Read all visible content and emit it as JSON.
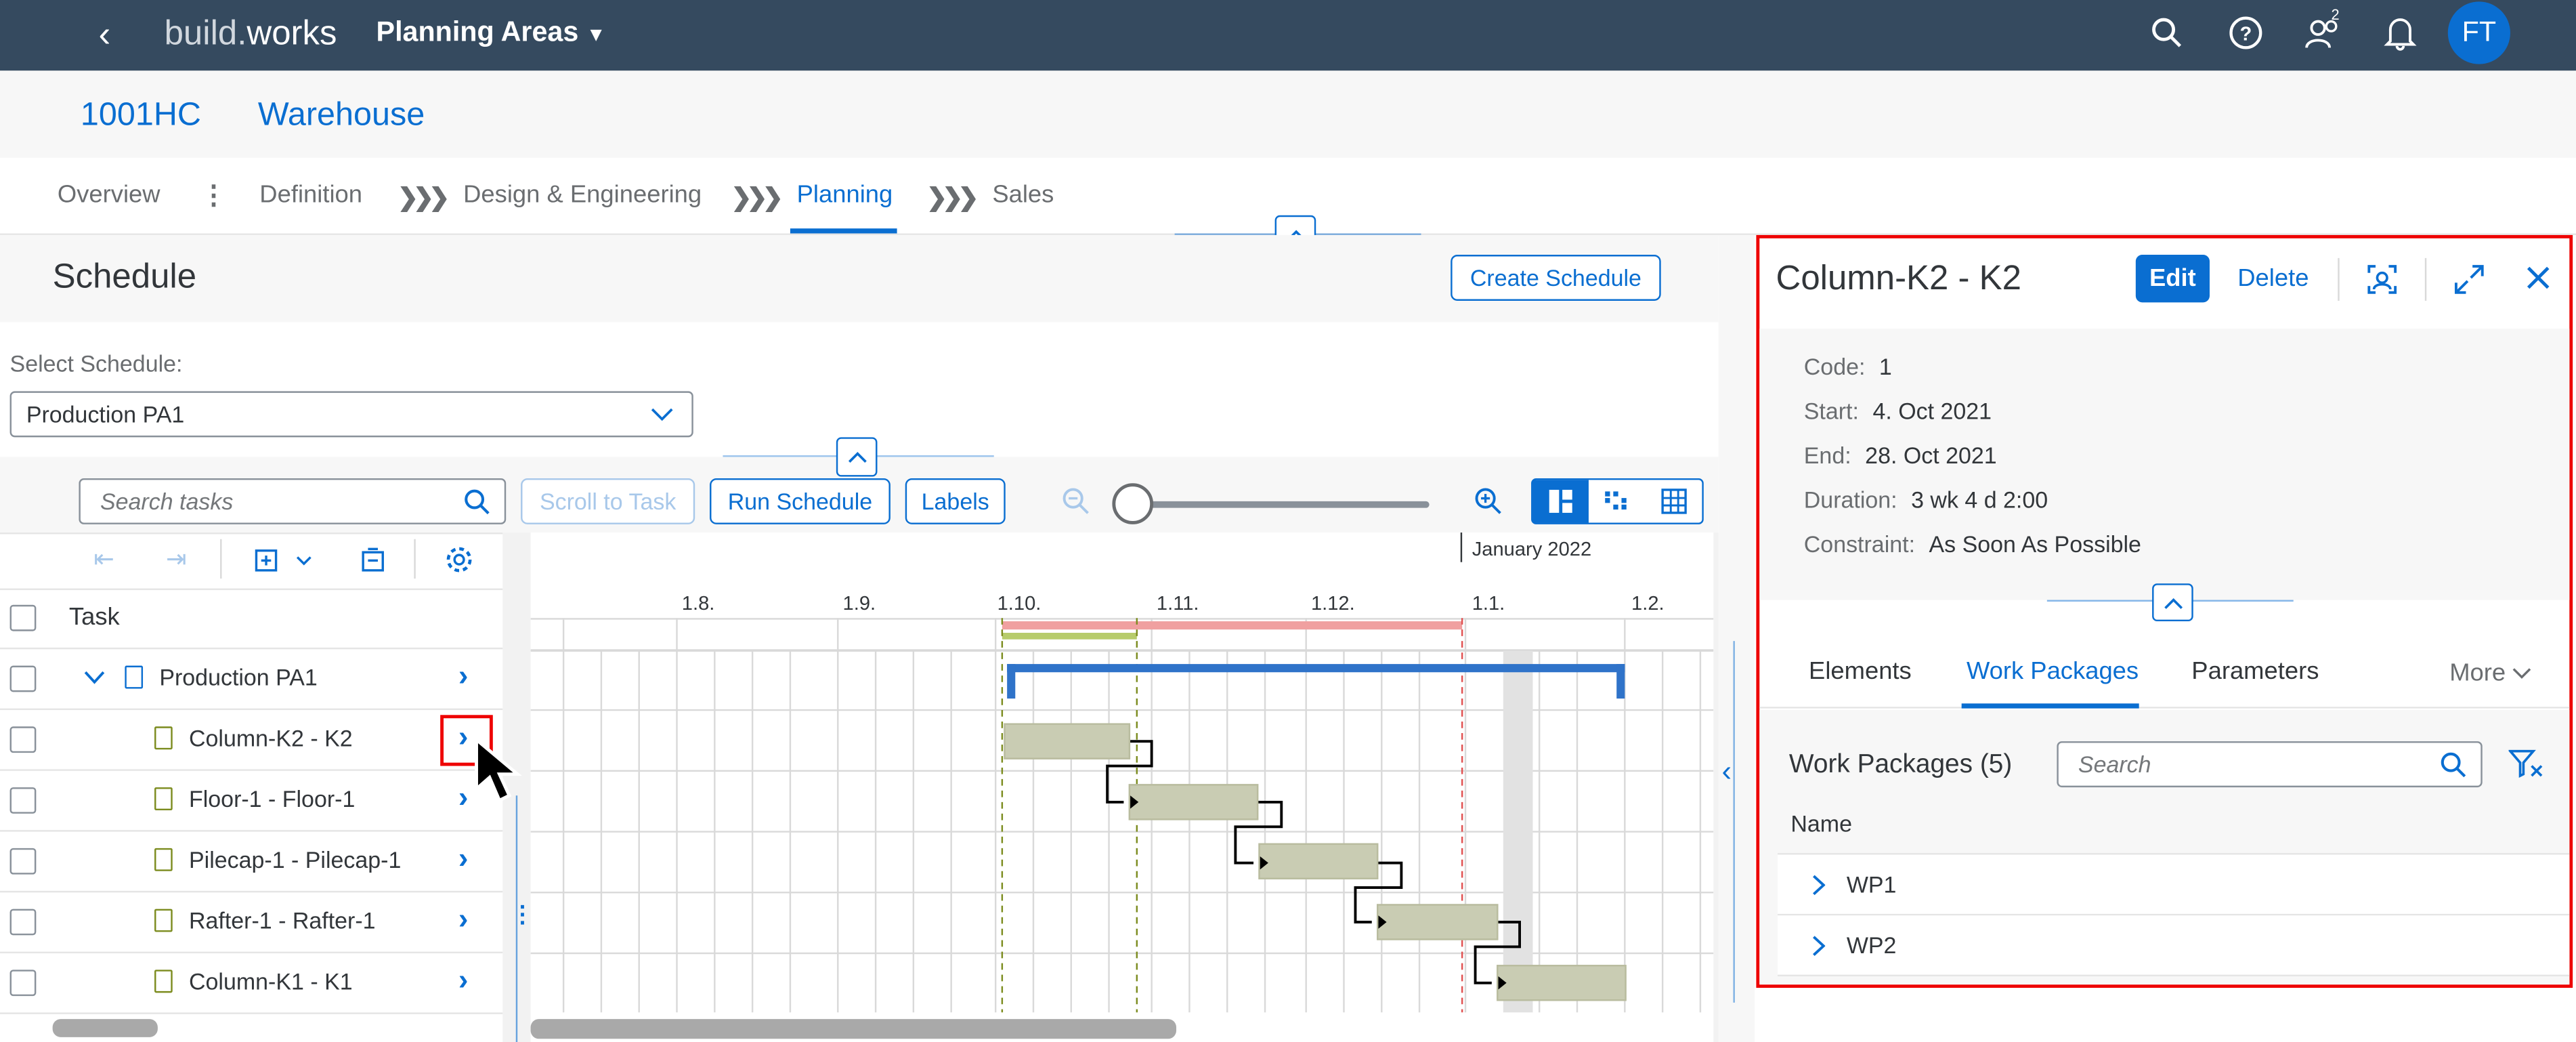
{
  "shell": {
    "app_name_1": "build.",
    "app_name_2": "works",
    "menu_title": "Planning Areas",
    "avatar": "FT",
    "notif_count": "2"
  },
  "header": {
    "id": "1001HC",
    "name": "Warehouse"
  },
  "nav": {
    "tabs": [
      "Overview",
      "Definition",
      "Design & Engineering",
      "Planning",
      "Sales"
    ],
    "active": "Planning"
  },
  "schedule": {
    "title": "Schedule",
    "create_label": "Create Schedule",
    "select_label": "Select Schedule:",
    "select_value": "Production PA1",
    "search_placeholder": "Search tasks",
    "scroll_label": "Scroll to Task",
    "run_label": "Run Schedule",
    "labels_label": "Labels",
    "task_header": "Task",
    "tasks": [
      "Production PA1",
      "Column-K2 - K2",
      "Floor-1 - Floor-1",
      "Pilecap-1 - Pilecap-1",
      "Rafter-1 - Rafter-1",
      "Column-K1 - K1"
    ],
    "year_label": "January 2022",
    "months": [
      "1.8.",
      "1.9.",
      "1.10.",
      "1.11.",
      "1.12.",
      "1.1.",
      "1.2."
    ]
  },
  "panel": {
    "title": "Column-K2 - K2",
    "edit_label": "Edit",
    "delete_label": "Delete",
    "fields": [
      {
        "label": "Code:",
        "value": "1"
      },
      {
        "label": "Start:",
        "value": "4. Oct 2021"
      },
      {
        "label": "End:",
        "value": "28. Oct 2021"
      },
      {
        "label": "Duration:",
        "value": "3 wk 4 d 2:00"
      },
      {
        "label": "Constraint:",
        "value": "As Soon As Possible"
      }
    ],
    "tabs": [
      "Elements",
      "Work Packages",
      "Parameters",
      "More"
    ],
    "wp_title": "Work Packages (5)",
    "wp_search_placeholder": "Search",
    "wp_col_name": "Name",
    "wp_rows": [
      "WP1",
      "WP2"
    ]
  },
  "colors": {
    "shell": "#354a5f",
    "accent": "#0a6ed1",
    "highlight": "#ee0000"
  }
}
